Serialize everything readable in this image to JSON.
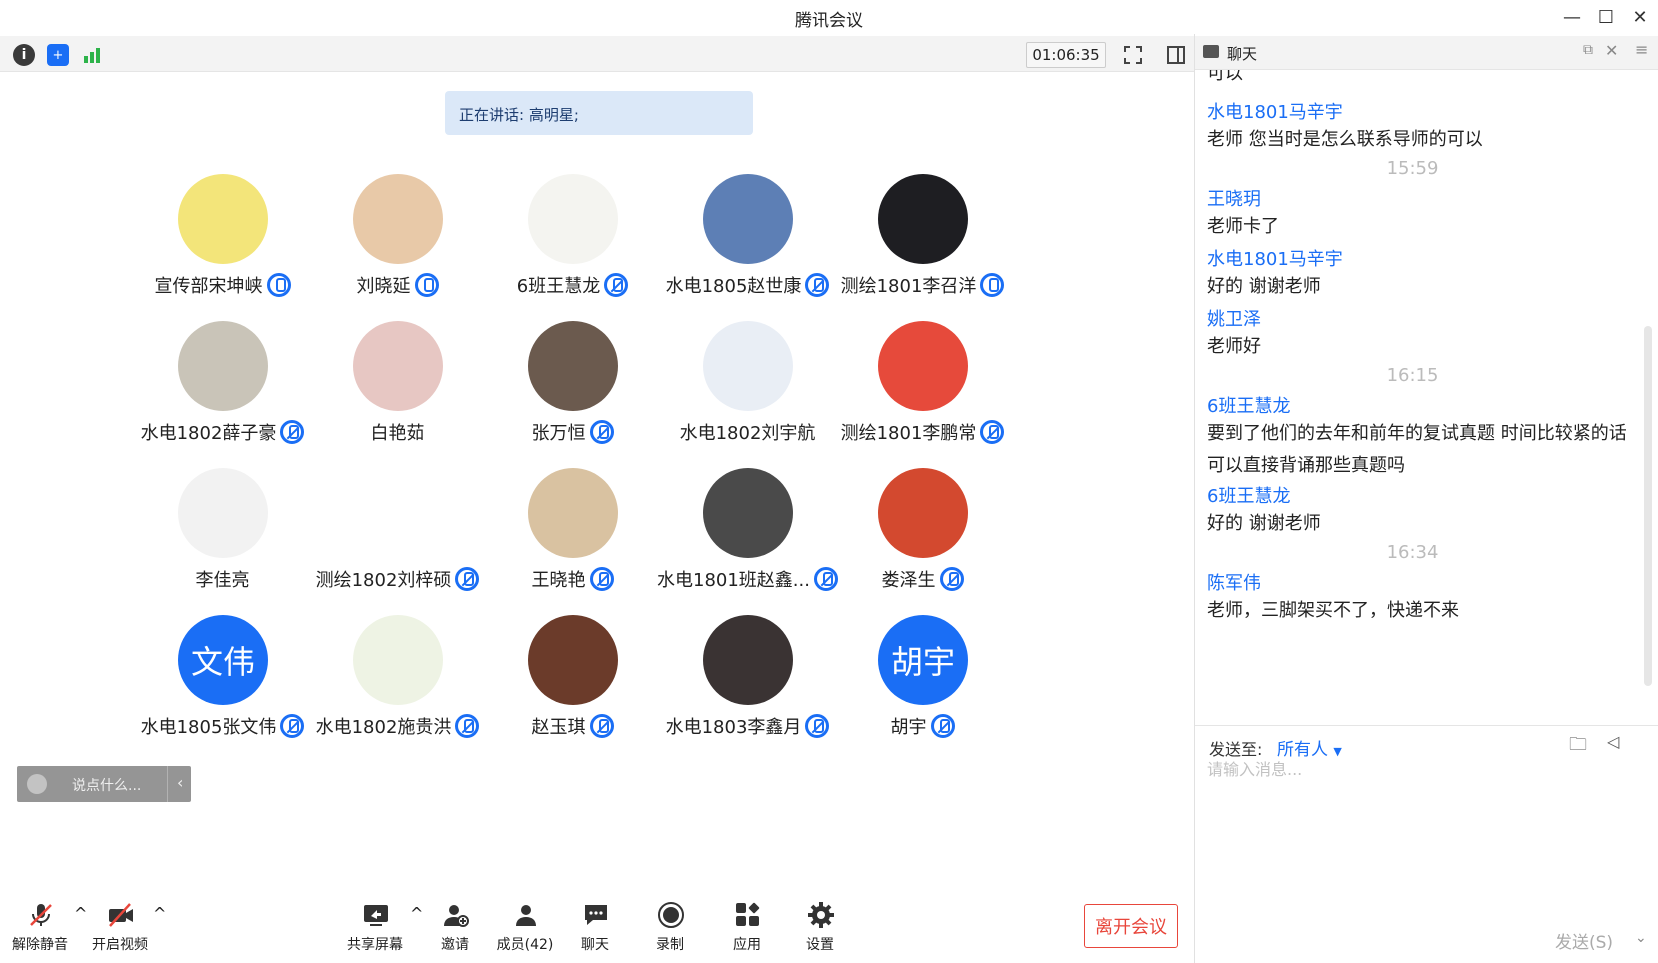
{
  "window": {
    "title": "腾讯会议"
  },
  "top_toolbar": {
    "timer": "01:06:35",
    "icons": [
      "info-icon",
      "shield-icon",
      "signal-icon",
      "fullscreen-icon",
      "sidebar-toggle-icon"
    ]
  },
  "speaking_banner": "正在讲话: 高明星;",
  "participants": [
    {
      "name": "宣传部宋坤峡",
      "mic": "on",
      "avatar": "bee",
      "avatar_color": "#f3e57a"
    },
    {
      "name": "刘晓延",
      "mic": "on",
      "avatar": "kitten",
      "avatar_color": "#e8c9a8"
    },
    {
      "name": "6班王慧龙",
      "mic": "muted",
      "avatar": "flower",
      "avatar_color": "#f4f4f0"
    },
    {
      "name": "水电1805赵世康",
      "mic": "muted",
      "avatar": "couple-cartoon",
      "avatar_color": "#5d7fb5"
    },
    {
      "name": "测绘1801李召洋",
      "mic": "on",
      "avatar": "night-scene",
      "avatar_color": "#1e1e22"
    },
    {
      "name": "水电1802薛子豪",
      "mic": "muted",
      "avatar": "ghost",
      "avatar_color": "#c9c4b8"
    },
    {
      "name": "白艳茹",
      "mic": "none",
      "avatar": "child-photo",
      "avatar_color": "#e7c7c3"
    },
    {
      "name": "张万恒",
      "mic": "muted",
      "avatar": "person-photo",
      "avatar_color": "#6b5a4e"
    },
    {
      "name": "水电1802刘宇航",
      "mic": "none",
      "avatar": "cat-monk",
      "avatar_color": "#e9eef5"
    },
    {
      "name": "测绘1801李鹏常",
      "mic": "muted",
      "avatar": "doraemon",
      "avatar_color": "#e64a3b"
    },
    {
      "name": "李佳亮",
      "mic": "none",
      "avatar": "cat-cartoon",
      "avatar_color": "#f2f2f2"
    },
    {
      "name": "测绘1802刘梓硕",
      "mic": "muted",
      "avatar": "black-cat",
      "avatar_color": "#ffffff"
    },
    {
      "name": "王晓艳",
      "mic": "muted",
      "avatar": "girl-illustration",
      "avatar_color": "#d9c2a1"
    },
    {
      "name": "水电1801班赵鑫...",
      "mic": "muted",
      "avatar": "moon-silhouette",
      "avatar_color": "#4a4a4a"
    },
    {
      "name": "娄泽生",
      "mic": "muted",
      "avatar": "red-sun",
      "avatar_color": "#d3492f"
    },
    {
      "name": "水电1805张文伟",
      "mic": "muted",
      "avatar_text": "文伟",
      "avatar_color": "#1a6ef5"
    },
    {
      "name": "水电1802施贵洪",
      "mic": "muted",
      "avatar": "duck",
      "avatar_color": "#eef3e4"
    },
    {
      "name": "赵玉琪",
      "mic": "muted",
      "avatar": "girl-photo",
      "avatar_color": "#6b3b2a"
    },
    {
      "name": "水电1803李鑫月",
      "mic": "muted",
      "avatar": "couple-photo",
      "avatar_color": "#3a3333"
    },
    {
      "name": "胡宇",
      "mic": "muted",
      "avatar_text": "胡宇",
      "avatar_color": "#1a6ef5"
    }
  ],
  "say_something": {
    "label": "说点什么..."
  },
  "bottom_bar": {
    "unmute": "解除静音",
    "start_video": "开启视频",
    "share_screen": "共享屏幕",
    "invite": "邀请",
    "members": "成员(42)",
    "chat": "聊天",
    "record": "录制",
    "apps": "应用",
    "settings": "设置",
    "leave": "离开会议"
  },
  "chat": {
    "title": "聊天",
    "partial_top": "可以",
    "messages": [
      {
        "type": "sender",
        "text": "水电1801马辛宇"
      },
      {
        "type": "text",
        "text": "老师  您当时是怎么联系导师的可以"
      },
      {
        "type": "time",
        "text": "15:59"
      },
      {
        "type": "sender",
        "text": "王晓玥"
      },
      {
        "type": "text",
        "text": "老师卡了"
      },
      {
        "type": "sender",
        "text": "水电1801马辛宇"
      },
      {
        "type": "text",
        "text": "好的  谢谢老师"
      },
      {
        "type": "sender",
        "text": "姚卫泽"
      },
      {
        "type": "text",
        "text": "老师好"
      },
      {
        "type": "time",
        "text": "16:15"
      },
      {
        "type": "sender",
        "text": "6班王慧龙"
      },
      {
        "type": "text",
        "text": "要到了他们的去年和前年的复试真题 时间比较紧的话 可以直接背诵那些真题吗"
      },
      {
        "type": "sender",
        "text": "6班王慧龙"
      },
      {
        "type": "text",
        "text": "好的 谢谢老师"
      },
      {
        "type": "time",
        "text": "16:34"
      },
      {
        "type": "sender",
        "text": "陈军伟"
      },
      {
        "type": "text",
        "text": "老师，三脚架买不了，快递不来"
      }
    ],
    "send_to_label": "发送至:",
    "send_to_value": "所有人",
    "input_placeholder": "请输入消息...",
    "send_button": "发送(S)"
  }
}
